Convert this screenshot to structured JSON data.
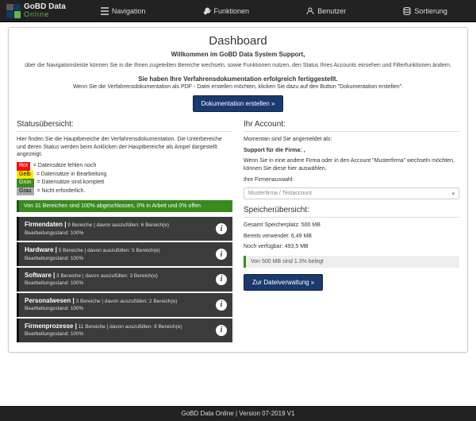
{
  "logo": {
    "line1": "GoBD Data",
    "line2": "Online"
  },
  "nav": {
    "navigation": "Navigation",
    "funktionen": "Funktionen",
    "benutzer": "Benutzer",
    "sortierung": "Sortierung"
  },
  "title": "Dashboard",
  "welcome": "Willkommen im GoBD Data System Support,",
  "intro": "über die Navigationsleiste können Sie in die Ihnen zugeteilten Bereiche wechseln, sowie Funktionen nutzen, den Status Ihres Accounts einsehen und Filterfunktionen ändern.",
  "done_title": "Sie haben Ihre Verfahrensdokumentation erfolgreich fertiggestellt.",
  "done_text": "Wenn Sie die Verfahrensdokumentation als PDF - Datei erstellen möchten, klicken Sie dazu auf den Button \"Dokumentation erstellen\".",
  "btn_doc": "Dokumentation erstellen »",
  "status": {
    "heading": "Statusübersicht:",
    "desc": "Hier finden Sie die Hauptbereiche der Verfahrensdokumentation. Die Unterbereiche und deren Status werden beim Anklicken der Hauptbereiche als Ampel dargestellt angezeigt.",
    "legend": {
      "red_label": "Rot",
      "red_text": " = Datensätze fehlen noch",
      "yellow_label": "Gelb",
      "yellow_text": " = Datensätze in Bearbeitung",
      "green_label": "Grün",
      "green_text": " = Datensätze sind komplett",
      "gray_label": "Grau",
      "gray_text": " = Nicht erforderlich."
    },
    "summary": "Von 31 Bereichen sind 100% abgeschlossen, 0% in Arbeit und 0% offen",
    "cats": [
      {
        "name": "Firmendaten |",
        "meta": " 9 Bereiche | davon auszufüllen: 6 Bereich(e)",
        "sub": "Bearbeitungsstand: 100%"
      },
      {
        "name": "Hardware |",
        "meta": " 5 Bereiche | davon auszufüllen: 5 Bereich(e)",
        "sub": "Bearbeitungsstand: 100%"
      },
      {
        "name": "Software |",
        "meta": " 3 Bereiche | davon auszufüllen: 3 Bereich(e)",
        "sub": "Bearbeitungsstand: 100%"
      },
      {
        "name": "Personalwesen |",
        "meta": " 3 Bereiche | davon auszufüllen: 2 Bereich(e)",
        "sub": "Bearbeitungsstand: 100%"
      },
      {
        "name": "Firmenprozesse |",
        "meta": " 11 Bereiche | davon auszufüllen: 8 Bereich(e)",
        "sub": "Bearbeitungsstand: 100%"
      }
    ]
  },
  "account": {
    "heading": "Ihr Account:",
    "l1": "Momentan sind Sie angemeldet als:",
    "l2": "Support für die Firma: ,",
    "l3": "Wenn Sie in eine andere Firma oder in den Account \"Musterfirma\" wechseln möchten, können Sie diese hier auswählen.",
    "select_label": "Ihre Firmenauswahl:",
    "select_value": "Musterfirma / Testaccount"
  },
  "storage": {
    "heading": "Speicherübersicht:",
    "total": "Gesamt Speicherplatz: 500 MB",
    "used": "Bereits verwendet: 6,49 MB",
    "free": "Noch verfügbar: 493,5 MB",
    "bar": "Von 500 MB sind 1.3% belegt",
    "btn": "Zur Dateiverwaltung »"
  },
  "footer": "GoBD Data Online | Version 07-2019 V1"
}
